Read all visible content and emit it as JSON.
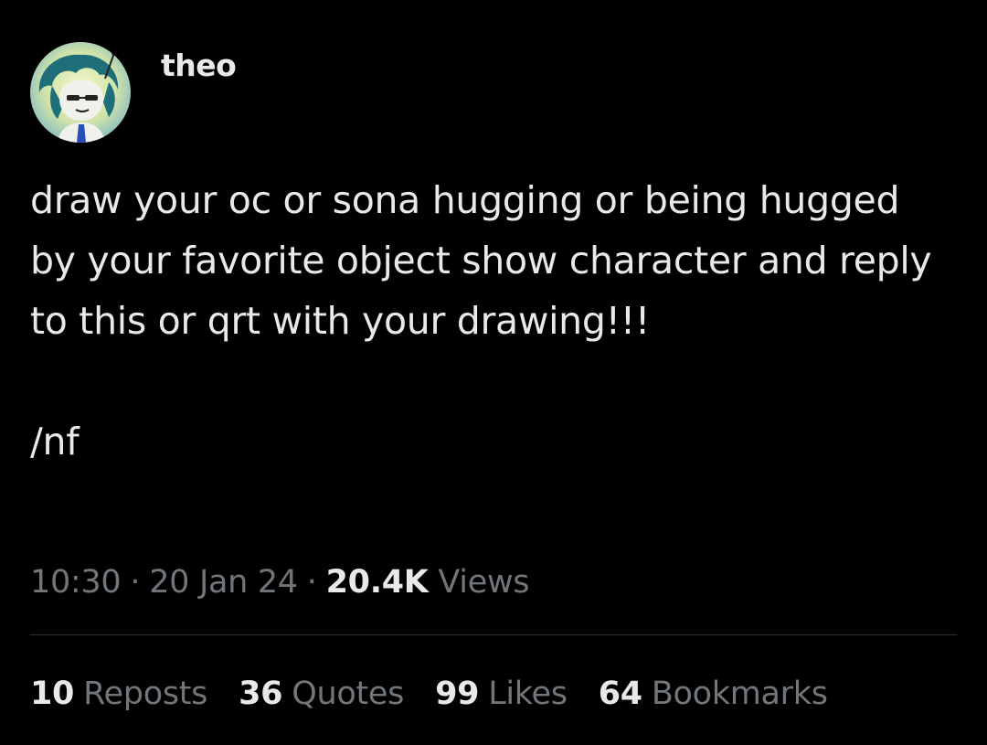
{
  "user": {
    "display_name": "theo",
    "avatar_icon": "cartoon-character-avatar"
  },
  "tweet": {
    "paragraph_1": "draw your oc or sona hugging or being hugged by your favorite object show character and reply to this or qrt with your drawing!!!",
    "paragraph_2": "/nf"
  },
  "meta": {
    "time": "10:30",
    "date": "20 Jan 24",
    "views_count": "20.4K",
    "views_label": "Views"
  },
  "stats": {
    "reposts": {
      "count": "10",
      "label": "Reposts"
    },
    "quotes": {
      "count": "36",
      "label": "Quotes"
    },
    "likes": {
      "count": "99",
      "label": "Likes"
    },
    "bookmarks": {
      "count": "64",
      "label": "Bookmarks"
    }
  },
  "colors": {
    "background": "#000000",
    "primary_text": "#e7e9ea",
    "secondary_text": "#71767b",
    "divider": "#2f3336"
  }
}
